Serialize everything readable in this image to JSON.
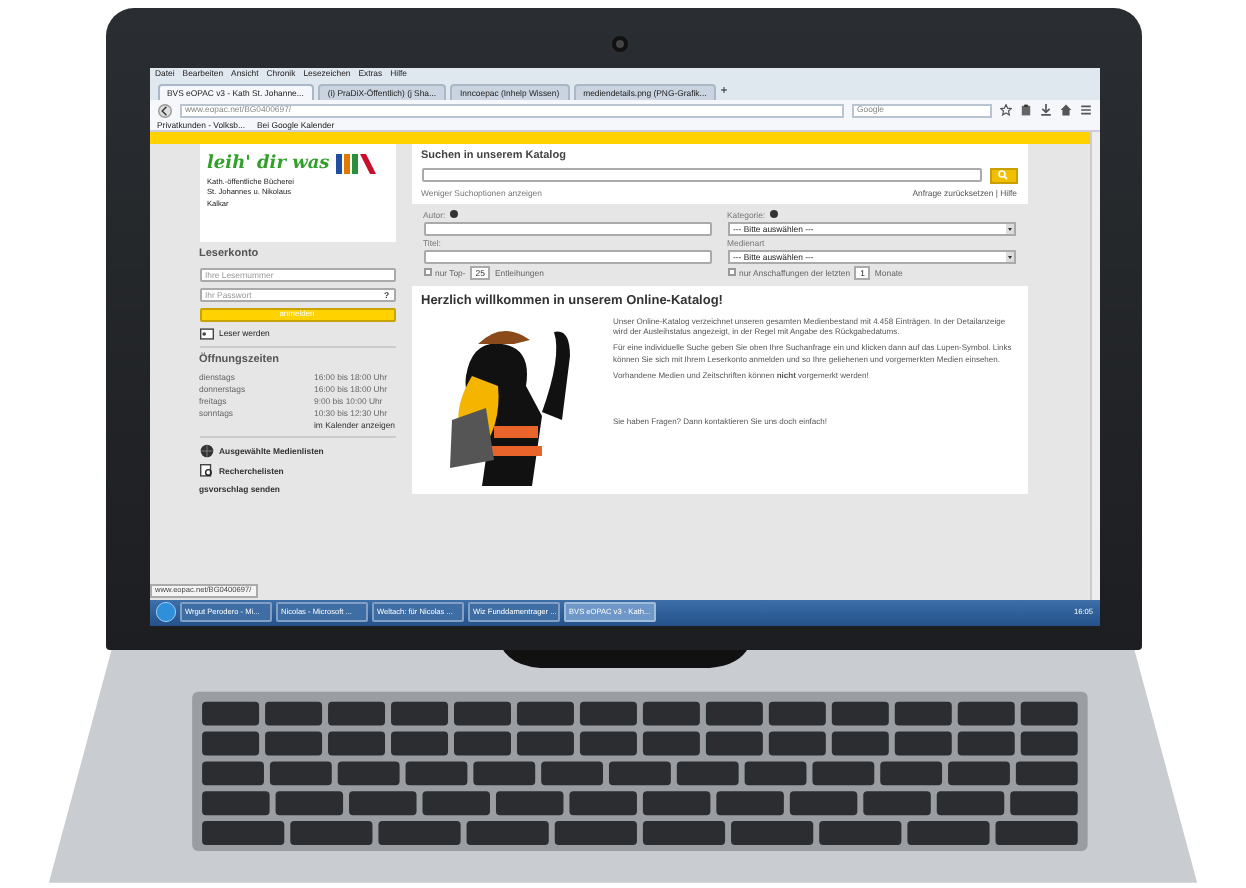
{
  "browser": {
    "menu": [
      "Datei",
      "Bearbeiten",
      "Ansicht",
      "Chronik",
      "Lesezeichen",
      "Extras",
      "Hilfe"
    ],
    "tabs": [
      {
        "label": "BVS eOPAC v3 - Kath St. Johanne...",
        "selected": true
      },
      {
        "label": "(i) PraDiX-Öffentlich) (j Sha...",
        "selected": false
      },
      {
        "label": "Inncoepac (Inhelp Wissen)",
        "selected": false
      },
      {
        "label": "mediendetails.png (PNG-Grafik...",
        "selected": false
      }
    ],
    "new_tab": "+",
    "url_host": "www.eopac.net",
    "url_path": "/BG0400697/",
    "search_placeholder": "Google",
    "bookmarks": [
      "Privatkunden - Volksb...",
      "Bei Google Kalender"
    ]
  },
  "sidebar": {
    "logo_text": "leih' dir was",
    "library": [
      "Kath.-öffentliche Bücherei",
      "St. Johannes u. Nikolaus",
      "Kalkar"
    ],
    "account_title": "Leserkonto",
    "reader_placeholder": "Ihre Lesernummer",
    "password_placeholder": "Ihr Passwort",
    "help": "?",
    "login": "anmelden",
    "register": "Leser werden",
    "hours_title": "Öffnungszeiten",
    "hours": [
      {
        "day": "dienstags",
        "time": "16:00 bis 18:00 Uhr"
      },
      {
        "day": "donnerstags",
        "time": "16:00 bis 18:00 Uhr"
      },
      {
        "day": "freitags",
        "time": "9:00 bis 10:00 Uhr"
      },
      {
        "day": "sonntags",
        "time": "10:30 bis 12:30 Uhr"
      }
    ],
    "calendar_link": "im Kalender anzeigen",
    "links": [
      {
        "kind": "globe",
        "label": "Ausgewählte Medienlisten"
      },
      {
        "kind": "search",
        "label": "Recherchelisten"
      },
      {
        "kind": "plain",
        "label": "gsvorschlag senden"
      }
    ],
    "status_url": "www.eopac.net/BG0400697/"
  },
  "search": {
    "title": "Suchen in unserem Katalog",
    "fewer": "Weniger Suchoptionen anzeigen",
    "reset": "Anfrage zurücksetzen | Hilfe",
    "author_label": "Autor:",
    "title_label": "Titel:",
    "top_checked": false,
    "top_label": "nur Top-",
    "top_value": "25",
    "top_suffix": "Entleihungen",
    "category_label": "Kategorie:",
    "category_value": "--- Bitte auswählen ---",
    "media_label": "Medienart",
    "media_value": "--- Bitte auswählen ---",
    "recent_checked": false,
    "recent_label": "nur Anschaffungen der letzten",
    "recent_value": "1",
    "recent_suffix": "Monate"
  },
  "welcome": {
    "title": "Herzlich willkommen in unserem Online-Katalog!",
    "paragraphs": [
      "Unser Online-Katalog verzeichnet unseren gesamten Medienbestand mit 4.458 Einträgen. In der Detailanzeige wird der Ausleihstatus angezeigt, in der Regel mit Angabe des Rückgabedatums.",
      "Für eine individuelle Suche geben Sie oben Ihre Suchanfrage ein und klicken dann auf das Lupen-Symbol. Links können Sie sich mit Ihrem Leserkonto anmelden und so Ihre geliehenen und vorgemerkten Medien einsehen.",
      "Vorhandene Medien und Zeitschriften können **nicht** vorgemerkt werden!"
    ],
    "contact": "Sie haben Fragen? Dann kontaktieren Sie uns doch einfach!"
  },
  "taskbar": {
    "items": [
      {
        "label": "Wrgut Perodero - Mi...",
        "selected": false
      },
      {
        "label": "Nicolas - Microsoft ...",
        "selected": false
      },
      {
        "label": "Weltach: für Nicolas ...",
        "selected": false
      },
      {
        "label": "Wiz Funddamentrager ...",
        "selected": false
      },
      {
        "label": "BVS eOPAC v3 - Kath...",
        "selected": true
      }
    ],
    "clock": "16:05"
  }
}
